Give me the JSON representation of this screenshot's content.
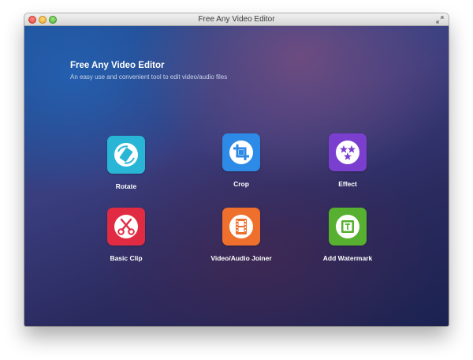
{
  "window": {
    "title": "Free Any Video Editor"
  },
  "header": {
    "title": "Free Any Video Editor",
    "subtitle": "An easy use and convenient tool to edit video/audio files"
  },
  "tools": [
    {
      "label": "Rotate",
      "icon": "rotate-icon",
      "color": "#29b6d6"
    },
    {
      "label": "Crop",
      "icon": "crop-icon",
      "color": "#2d8ae6"
    },
    {
      "label": "Effect",
      "icon": "stars-icon",
      "color": "#7b3fd0"
    },
    {
      "label": "Basic Clip",
      "icon": "scissors-icon",
      "color": "#e02b42"
    },
    {
      "label": "Video/Audio Joiner",
      "icon": "film-icon",
      "color": "#ef6f2c"
    },
    {
      "label": "Add Watermark",
      "icon": "watermark-icon",
      "color": "#58b030"
    }
  ]
}
